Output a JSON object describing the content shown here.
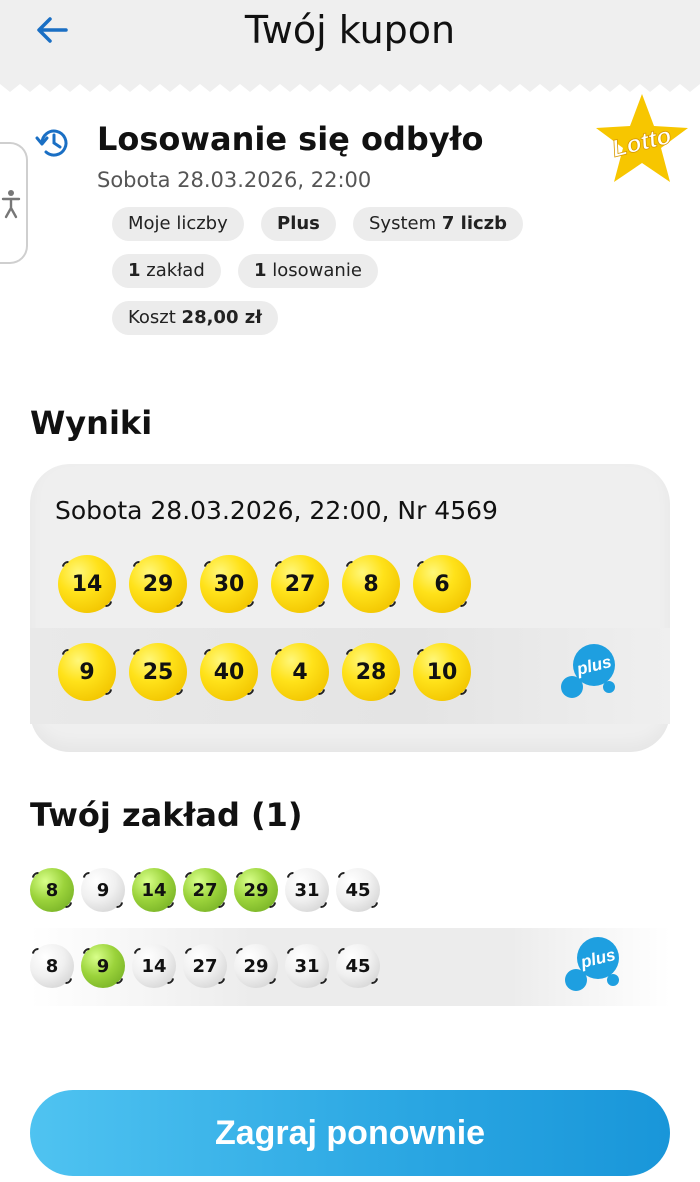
{
  "header": {
    "title": "Twój kupon",
    "back_icon": "arrow-left-icon"
  },
  "draw": {
    "title": "Losowanie się odbyło",
    "date": "Sobota 28.03.2026, 22:00",
    "brand": "Lotto"
  },
  "chips": {
    "my_numbers": "Moje liczby",
    "plus": "Plus",
    "system_label": "System",
    "system_value": "7 liczb",
    "bets_count": "1",
    "bets_label": "zakład",
    "draws_count": "1",
    "draws_label": "losowanie",
    "cost_label": "Koszt",
    "cost_value": "28,00 zł"
  },
  "results": {
    "heading": "Wyniki",
    "draw_line": "Sobota 28.03.2026, 22:00, Nr 4569",
    "lotto_numbers": [
      "14",
      "29",
      "30",
      "27",
      "8",
      "6"
    ],
    "plus_numbers": [
      "9",
      "25",
      "40",
      "4",
      "28",
      "10"
    ],
    "plus_logo_text": "plus"
  },
  "bet": {
    "heading": "Twój zakład (1)",
    "lotto_row": [
      {
        "n": "8",
        "hit": true
      },
      {
        "n": "9",
        "hit": false
      },
      {
        "n": "14",
        "hit": true
      },
      {
        "n": "27",
        "hit": true
      },
      {
        "n": "29",
        "hit": true
      },
      {
        "n": "31",
        "hit": false
      },
      {
        "n": "45",
        "hit": false
      }
    ],
    "plus_row": [
      {
        "n": "8",
        "hit": false
      },
      {
        "n": "9",
        "hit": true
      },
      {
        "n": "14",
        "hit": false
      },
      {
        "n": "27",
        "hit": false
      },
      {
        "n": "29",
        "hit": false
      },
      {
        "n": "31",
        "hit": false
      },
      {
        "n": "45",
        "hit": false
      }
    ],
    "plus_logo_text": "plus"
  },
  "actions": {
    "play_again": "Zagraj ponownie"
  },
  "colors": {
    "accent": "#2aa6e2",
    "ball_yellow": "#ffe21a",
    "ball_green": "#9bd33b",
    "ball_grey": "#e6e6e6",
    "logo_star": "#f7c600"
  }
}
